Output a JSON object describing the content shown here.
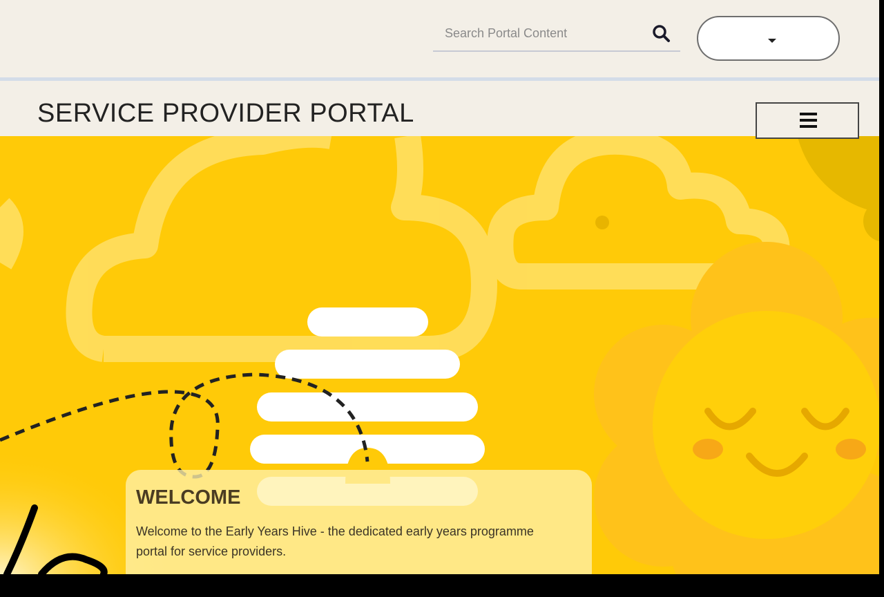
{
  "search": {
    "placeholder": "Search Portal Content",
    "icon": "search-icon"
  },
  "language_selector": {
    "label": "",
    "icon": "caret-down-icon"
  },
  "header": {
    "title": "SERVICE PROVIDER PORTAL",
    "menu_icon": "hamburger-menu-icon"
  },
  "welcome": {
    "title": "WELCOME",
    "text": "Welcome to the Early Years Hive - the dedicated early years programme portal for service providers."
  },
  "colors": {
    "background": "#f3efe7",
    "divider": "#d3dce8",
    "hero_yellow": "#ffca08",
    "card": "#fff1aa",
    "text_dark": "#4a3c22"
  }
}
